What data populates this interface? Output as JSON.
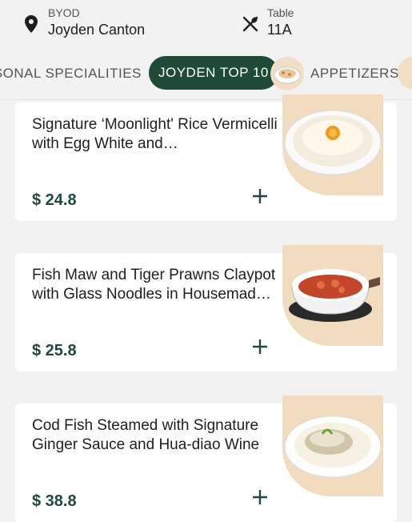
{
  "header": {
    "location_label": "BYOD",
    "location_name": "Joyden Canton",
    "table_label": "Table",
    "table_number": "11A"
  },
  "tabs": [
    {
      "label": "ASONAL SPECIALITIES",
      "active": false
    },
    {
      "label": "JOYDEN TOP 10",
      "active": true
    },
    {
      "label": "APPETIZERS",
      "active": false
    }
  ],
  "menu_items": [
    {
      "name": "Signature ‘Moonlight' Rice Vermicelli with Egg White and…",
      "price": "$ 24.8",
      "add_label": "+"
    },
    {
      "name": "Fish Maw and Tiger Prawns Claypot with Glass Noodles in Housemad…",
      "price": "$ 25.8",
      "add_label": "+"
    },
    {
      "name": "Cod Fish Steamed with Signature Ginger Sauce and Hua-diao Wine",
      "price": "$ 38.8",
      "add_label": "+"
    }
  ],
  "icons": {
    "location": "location-pin-icon",
    "table": "utensils-icon",
    "add": "plus-icon"
  },
  "colors": {
    "accent": "#1f4a38",
    "background": "#f2f2f2",
    "image_backdrop": "#f2dcc0"
  }
}
